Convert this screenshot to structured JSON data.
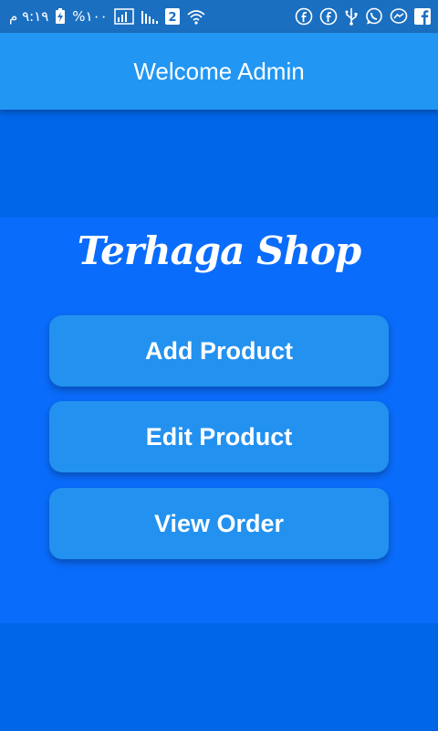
{
  "status_bar": {
    "time": "٩:١٩ م",
    "battery": "%١٠٠",
    "sim_label": "2",
    "icons": [
      "charging-icon",
      "signal-icon",
      "signal-icon",
      "sim-icon",
      "wifi-icon",
      "facebook-icon",
      "facebook-icon",
      "usb-icon",
      "whatsapp-icon",
      "messenger-icon",
      "facebook-square-icon"
    ]
  },
  "appbar": {
    "title": "Welcome Admin"
  },
  "main": {
    "shop_title": "Terhaga Shop",
    "buttons": [
      {
        "label": "Add Product"
      },
      {
        "label": "Edit Product"
      },
      {
        "label": "View Order"
      }
    ]
  },
  "colors": {
    "background": "#0066e8",
    "panel": "#0a6cfb",
    "appbar": "#2196f3",
    "button": "#2391ef",
    "status_bar": "#1b6fc0"
  }
}
